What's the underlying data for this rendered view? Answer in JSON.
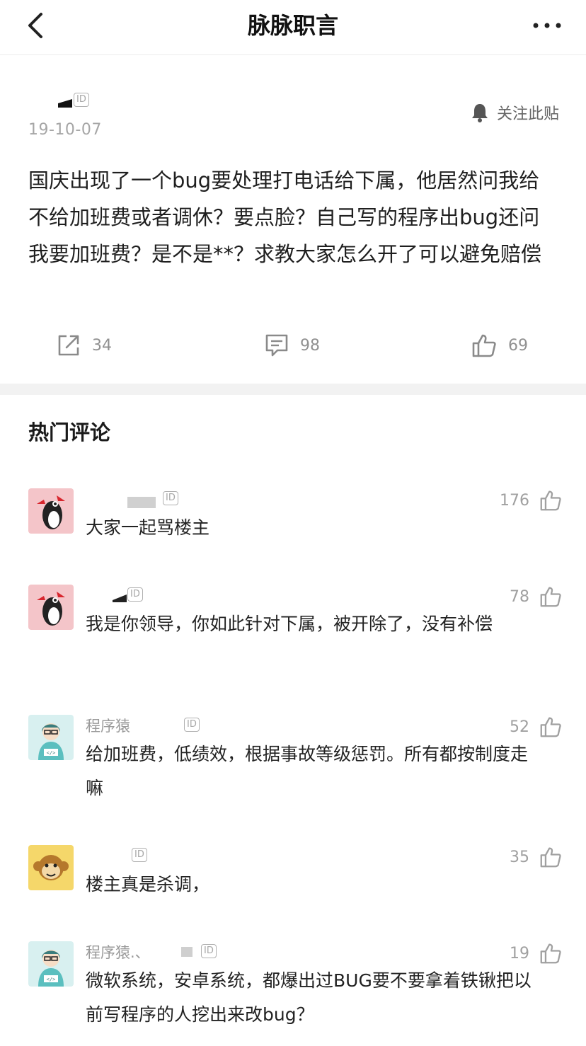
{
  "nav": {
    "title": "脉脉职言",
    "back_icon": "chevron-left-icon",
    "more_icon": "more-dots-icon"
  },
  "post": {
    "id_badge": "ID",
    "date": "19-10-07",
    "follow_label": "关注此贴",
    "follow_icon": "bell-icon",
    "body": "国庆出现了一个bug要处理打电话给下属，他居然问我给不给加班费或者调休？要点脸？自己写的程序出bug还问我要加班费？是不是**？求教大家怎么开了可以避免赔偿",
    "actions": {
      "share_count": "34",
      "comment_count": "98",
      "like_count": "69"
    }
  },
  "hot_comments": {
    "title": "热门评论",
    "items": [
      {
        "name": "",
        "id_badge": "ID",
        "text": "大家一起骂楼主",
        "likes": "176",
        "avatar": "woodpecker"
      },
      {
        "name": "",
        "id_badge": "ID",
        "text": "我是你领导，你如此针对下属，被开除了，没有补偿",
        "likes": "78",
        "avatar": "woodpecker"
      },
      {
        "name": "程序猿",
        "id_badge": "ID",
        "text": "给加班费，低绩效，根据事故等级惩罚。所有都按制度走嘛",
        "likes": "52",
        "avatar": "coder"
      },
      {
        "name": "",
        "id_badge": "ID",
        "text": "楼主真是杀调，",
        "likes": "35",
        "avatar": "monkey"
      },
      {
        "name": "程序猿.、",
        "id_badge": "ID",
        "text": "微软系统，安卓系统，都爆出过BUG要不要拿着铁锹把以前写程序的人挖出来改bug？",
        "likes": "19",
        "avatar": "coder"
      }
    ]
  },
  "colors": {
    "divider": "#f2f2f2",
    "muted_text": "#a6a6a6",
    "woodpecker_bg": "#f4c5c9",
    "coder_bg": "#d8f0f0",
    "monkey_bg": "#f5d76a"
  }
}
